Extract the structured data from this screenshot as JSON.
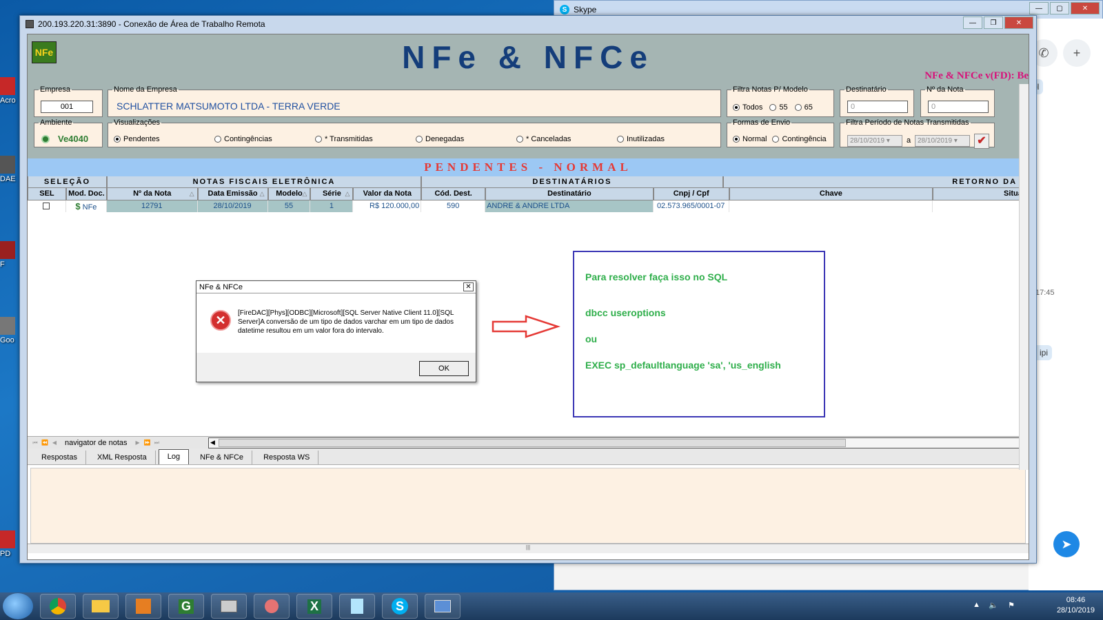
{
  "desktop": {
    "icons": [
      {
        "label": "Acro"
      },
      {
        "label": "DAE"
      },
      {
        "label": "F"
      },
      {
        "label": "Goo"
      },
      {
        "label": "PD"
      }
    ]
  },
  "skype": {
    "title": "Skype",
    "chat": {
      "bubble1": "ol",
      "time": "17:45",
      "bubble2": "n ipi"
    }
  },
  "rdp": {
    "title": "200.193.220.31:3890 - Conexão de Área de Trabalho Remota"
  },
  "app": {
    "logo": "NFe",
    "title": "NFe & NFCe",
    "version": "NFe & NFCe v(FD): Be",
    "empresa": {
      "legend": "Empresa",
      "value": "001"
    },
    "nome_empresa": {
      "legend": "Nome da Empresa",
      "value": "SCHLATTER  MATSUMOTO LTDA - TERRA VERDE"
    },
    "filtra_modelo": {
      "legend": "Filtra Notas P/ Modelo",
      "options": [
        "Todos",
        "55",
        "65"
      ],
      "selected": "Todos"
    },
    "destinatario": {
      "legend": "Destinatário",
      "value": "0"
    },
    "nr_nota": {
      "legend": "Nº da Nota",
      "value": "0"
    },
    "ambiente": {
      "legend": "Ambiente",
      "value": "Ve4040"
    },
    "visualizacoes": {
      "legend": "Visualizações",
      "options": [
        "Pendentes",
        "Contingências",
        "* Transmitidas",
        "Denegadas",
        "* Canceladas",
        "Inutilizadas"
      ],
      "selected": "Pendentes"
    },
    "formas_envio": {
      "legend": "Formas de Envio",
      "options": [
        "Normal",
        "Contingência"
      ],
      "selected": "Normal"
    },
    "periodo": {
      "legend": "Filtra Período de Notas Transmitidas",
      "from": "28/10/2019",
      "sep": "a",
      "to": "28/10/2019"
    },
    "status_band": "PENDENTES - NORMAL",
    "grid": {
      "groups": [
        "SELEÇÃO",
        "NOTAS FISCAIS ELETRÔNICA",
        "DESTINATÁRIOS",
        "RETORNO DA S"
      ],
      "columns": [
        "SEL",
        "Mod. Doc.",
        "Nº da Nota",
        "Data Emissão",
        "Modelo",
        "Série",
        "Valor da Nota",
        "Cód. Dest.",
        "Destinatário",
        "Cnpj / Cpf",
        "Chave",
        "Situaç"
      ],
      "rows": [
        {
          "mod": "NFe",
          "nota": "12791",
          "data": "28/10/2019",
          "modelo": "55",
          "serie": "1",
          "valor": "R$ 120.000,00",
          "cod": "590",
          "dest": "ANDRE & ANDRE LTDA",
          "cnpj": "02.573.965/0001-07",
          "chave": "",
          "situacao": ""
        }
      ]
    },
    "navigator_label": "navigator de notas",
    "tabs": [
      "Respostas",
      "XML Resposta",
      "Log",
      "NFe & NFCe",
      "Resposta WS"
    ],
    "active_tab": "Log"
  },
  "dialog": {
    "title": "NFe & NFCe",
    "message": "[FireDAC][Phys][ODBC][Microsoft][SQL Server Native Client 11.0][SQL Server]A conversão de um tipo de dados varchar em um tipo de dados datetime resultou em um valor fora do intervalo.",
    "ok": "OK"
  },
  "annotation": {
    "line1": "Para resolver faça isso no SQL",
    "line2": "dbcc useroptions",
    "line3": "ou",
    "line4": "EXEC sp_defaultlanguage 'sa', 'us_english"
  },
  "taskbar": {
    "time": "08:46",
    "date": "28/10/2019"
  },
  "colors": {
    "title_blue": "#143d7a",
    "version_pink": "#d8107a",
    "band_red": "#e53935",
    "note_green": "#2eae4a",
    "note_border": "#3b36b5"
  }
}
